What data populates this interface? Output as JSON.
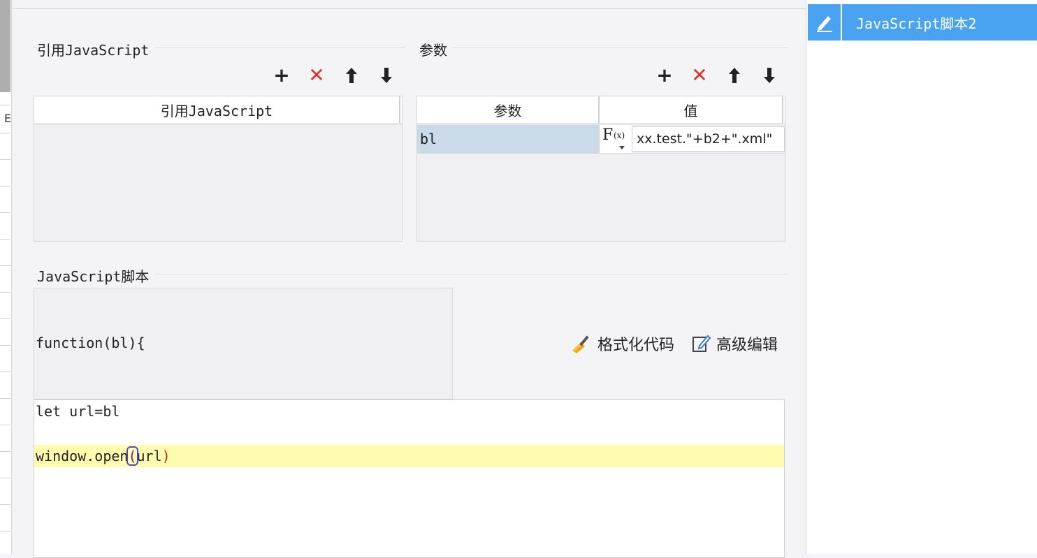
{
  "left_strip": {
    "letter": "E"
  },
  "reference_js": {
    "section_title": "引用JavaScript",
    "column_header": "引用JavaScript",
    "toolbar": {
      "add": "+",
      "delete": "✕"
    }
  },
  "params": {
    "section_title": "参数",
    "columns": [
      "参数",
      "值"
    ],
    "rows": [
      {
        "name": "bl",
        "value": "xx.test.\"+b2+\".xml\""
      }
    ],
    "toolbar": {
      "add": "+",
      "delete": "✕"
    }
  },
  "script": {
    "section_title": "JavaScript脚本",
    "function_signature": "function(bl){",
    "format_label": "格式化代码",
    "advanced_label": "高级编辑",
    "code": {
      "line1": "let url=bl",
      "line3_prefix": "window.open",
      "paren_open": "(",
      "arg": "url",
      "paren_close": ")"
    }
  },
  "right_panel": {
    "items": [
      {
        "label": "JavaScript脚本2",
        "icon": "pencil-icon",
        "selected": true
      }
    ]
  },
  "colors": {
    "accent": "#4aa3f0",
    "delete": "#e0302a",
    "highlight_line": "#fffcaf",
    "selected_row": "#c9dbe8"
  }
}
